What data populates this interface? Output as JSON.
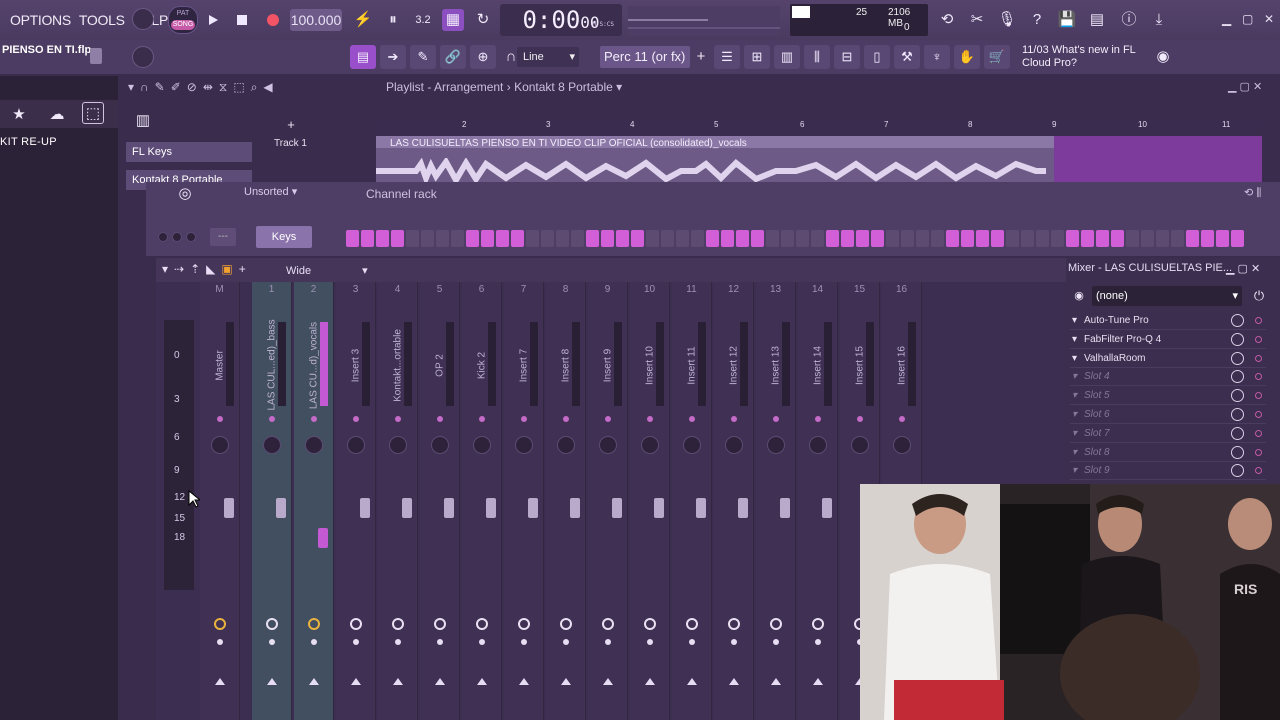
{
  "menu": {
    "items": [
      "OPTIONS",
      "TOOLS",
      "HELP"
    ]
  },
  "transport": {
    "pat_label": "PAT",
    "song_label": "SONG",
    "tempo": "100.000",
    "time": "0:00",
    "time_small": "00",
    "time_unit": "M:S:CS"
  },
  "cpu": {
    "value1": "25",
    "memory": "2106 MB",
    "value2": "0"
  },
  "project": {
    "filename": "PIENSO EN TI.flp"
  },
  "toolbar2": {
    "snap": "Line",
    "channel": "Perc 11 (or fx)"
  },
  "news": {
    "date": "11/03",
    "text": "What's new in FL Cloud Pro?"
  },
  "browser": {
    "item": "KIT RE-UP"
  },
  "playlist": {
    "title": "Playlist - Arrangement",
    "pattern": "Kontakt 8 Portable",
    "ruler": [
      "2",
      "3",
      "4",
      "5",
      "6",
      "7",
      "8",
      "9",
      "10",
      "11"
    ],
    "track": "Track 1",
    "clip": "LAS CULISUELTAS PIENSO EN TI VIDEO CLIP OFICIAL (consolidated)_vocals",
    "side_items": [
      "FL Keys",
      "Kontakt 8 Portable"
    ]
  },
  "channel_rack": {
    "title": "Channel rack",
    "filter": "Unsorted",
    "channel": "Keys",
    "steps": [
      1,
      1,
      1,
      1,
      0,
      0,
      0,
      0,
      1,
      1,
      1,
      1,
      0,
      0,
      0,
      0,
      1,
      1,
      1,
      1,
      0,
      0,
      0,
      0,
      1,
      1,
      1,
      1,
      0,
      0,
      0,
      0,
      1,
      1,
      1,
      1,
      0,
      0,
      0,
      0,
      1,
      1,
      1,
      1,
      0,
      0,
      0,
      0,
      1,
      1,
      1,
      1,
      0,
      0,
      0,
      0,
      1,
      1,
      1,
      1
    ]
  },
  "mixer": {
    "view": "Wide",
    "title": "Mixer - LAS CULISUELTAS PIE...",
    "preset": "(none)",
    "db_scale": [
      "0",
      "3",
      "6",
      "9",
      "12",
      "15",
      "18"
    ],
    "strips": [
      {
        "num": "C",
        "name": ""
      },
      {
        "num": "M",
        "name": "Master"
      },
      {
        "num": "1",
        "name": "LAS CUL...ed)_bass"
      },
      {
        "num": "2",
        "name": "LAS CU...d)_vocals"
      },
      {
        "num": "3",
        "name": "Insert 3"
      },
      {
        "num": "4",
        "name": "Kontakt...ortable"
      },
      {
        "num": "5",
        "name": "OP 2"
      },
      {
        "num": "6",
        "name": "Kick 2"
      },
      {
        "num": "7",
        "name": "Insert 7"
      },
      {
        "num": "8",
        "name": "Insert 8"
      },
      {
        "num": "9",
        "name": "Insert 9"
      },
      {
        "num": "10",
        "name": "Insert 10"
      },
      {
        "num": "11",
        "name": "Insert 11"
      },
      {
        "num": "12",
        "name": "Insert 12"
      },
      {
        "num": "13",
        "name": "Insert 13"
      },
      {
        "num": "14",
        "name": "Insert 14"
      },
      {
        "num": "15",
        "name": "Insert 15"
      },
      {
        "num": "16",
        "name": "Insert 16"
      }
    ],
    "slots": [
      {
        "name": "Auto-Tune Pro",
        "empty": false
      },
      {
        "name": "FabFilter Pro-Q 4",
        "empty": false
      },
      {
        "name": "ValhallaRoom",
        "empty": false
      },
      {
        "name": "Slot 4",
        "empty": true
      },
      {
        "name": "Slot 5",
        "empty": true
      },
      {
        "name": "Slot 6",
        "empty": true
      },
      {
        "name": "Slot 7",
        "empty": true
      },
      {
        "name": "Slot 8",
        "empty": true
      },
      {
        "name": "Slot 9",
        "empty": true
      }
    ]
  },
  "colors": {
    "accent": "#c65ad0",
    "step_on": "#d25fd8",
    "step_off": "#5d4b72",
    "selected_strip": "#4a8d7e"
  }
}
